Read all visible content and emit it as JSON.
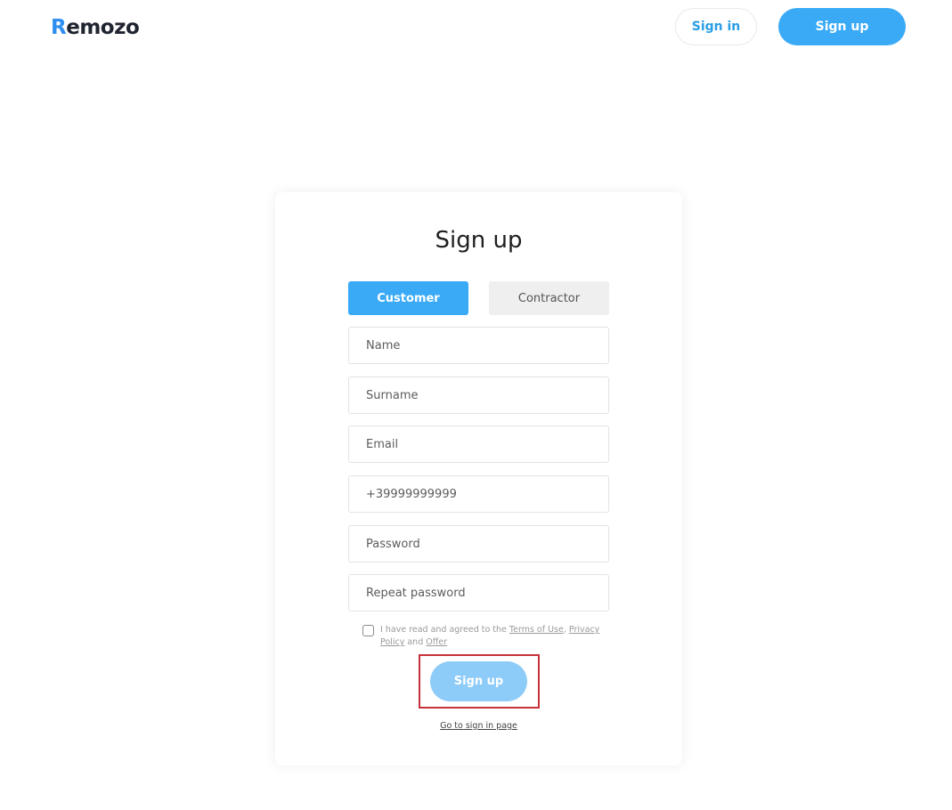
{
  "header": {
    "logo_first": "R",
    "logo_rest": "emozo",
    "signin_label": "Sign in",
    "signup_label": "Sign up"
  },
  "form": {
    "title": "Sign up",
    "tabs": [
      {
        "label": "Customer",
        "active": true
      },
      {
        "label": "Contractor",
        "active": false
      }
    ],
    "fields": {
      "name": {
        "placeholder": "Name",
        "value": ""
      },
      "surname": {
        "placeholder": "Surname",
        "value": ""
      },
      "email": {
        "placeholder": "Email",
        "value": ""
      },
      "phone": {
        "placeholder": "+39999999999",
        "value": ""
      },
      "password": {
        "placeholder": "Password",
        "value": ""
      },
      "repeat_password": {
        "placeholder": "Repeat password",
        "value": ""
      }
    },
    "agreement": {
      "checked": false,
      "prefix": "I have read and agreed to the ",
      "terms": "Terms of Use",
      "sep1": ", ",
      "privacy": "Privacy Policy",
      "sep2": " and ",
      "offer": "Offer"
    },
    "submit_label": "Sign up",
    "signin_link": "Go to sign in page"
  },
  "colors": {
    "accent": "#3aaaf7",
    "submit_disabled": "#8dcbf8",
    "highlight": "#c8303a",
    "logo_accent": "#2f8ff0"
  }
}
